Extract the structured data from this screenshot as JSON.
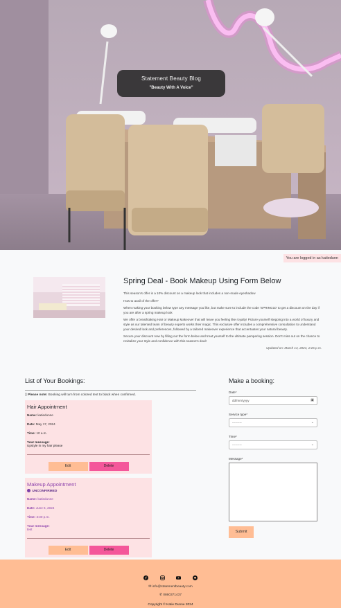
{
  "hero": {
    "title": "Statement Beauty Blog",
    "subtitle": "\"Beauty With A Voice\""
  },
  "auth": {
    "status": "You are logged in as katiedunn"
  },
  "article": {
    "title": "Spring Deal - Book Makeup Using Form Below",
    "paragraphs": [
      "This season's offer is a 10% discount on a makeup look that includes a non-made eyeshadow",
      "How to avail of the offer?",
      "When making your booking below type any message you like, but make sure to include the code 'SPRING10' to get a discount on the day if you are after a spring makeup look",
      "We offer a breathtaking Hair or Makeup Makeover that will leave you feeling like royalty! Picture yourself stepping into a world of luxury and style as our talented team of beauty experts works their magic. This exclusive offer includes a comprehensive consultation to understand your desired look and preferences, followed by a tailored makeover experience that accentuates your natural beauty.",
      "Secure your discount now by filling out the form below and treat yourself to the ultimate pampering session. Don't miss out on the chance to revitalize your style and confidence with this season's deal!"
    ],
    "updated": "Updated on: March 14, 2024, 2:26 p.m."
  },
  "bookings": {
    "heading": "List of Your Bookings:",
    "note_label": "Please note:",
    "note_text": " Booking will turn from colored text to black when confirmed.",
    "items": [
      {
        "title": "Hair Appointment",
        "status": "",
        "name_label": "Name:",
        "name": "katiedunne",
        "date_label": "Date:",
        "date": "May 17, 2024",
        "time_label": "Time:",
        "time": "10 a.m.",
        "message_label": "Your message:",
        "message": "Upstyle in my hair please",
        "edit": "Edit",
        "delete": "Delete"
      },
      {
        "title": "Makeup Appointment",
        "status": "UNCONFIRMED",
        "name_label": "Name:",
        "name": "katiedunne",
        "date_label": "Date:",
        "date": "June 6, 2024",
        "time_label": "Time:",
        "time": "3:30 p.m.",
        "message_label": "Your message:",
        "message": "test",
        "edit": "Edit",
        "delete": "Delete"
      }
    ]
  },
  "form": {
    "heading": "Make a booking:",
    "date_label": "Date*",
    "date_placeholder": "dd/mm/yyyy",
    "service_label": "Service type*",
    "service_value": "---------",
    "time_label": "Time*",
    "time_value": "---------",
    "message_label": "Message*",
    "submit": "Submit"
  },
  "footer": {
    "email": "info@statementbeauty.com",
    "phone": "0860371437",
    "copyright": "Copyright © Katie Dunne 2024",
    "icons": [
      "facebook-icon",
      "instagram-icon",
      "youtube-icon",
      "github-icon"
    ]
  },
  "colors": {
    "peach": "#ffbd94",
    "pink": "#fde2e4",
    "delete": "#f4579a",
    "unconfirmed": "#8e44ad"
  }
}
